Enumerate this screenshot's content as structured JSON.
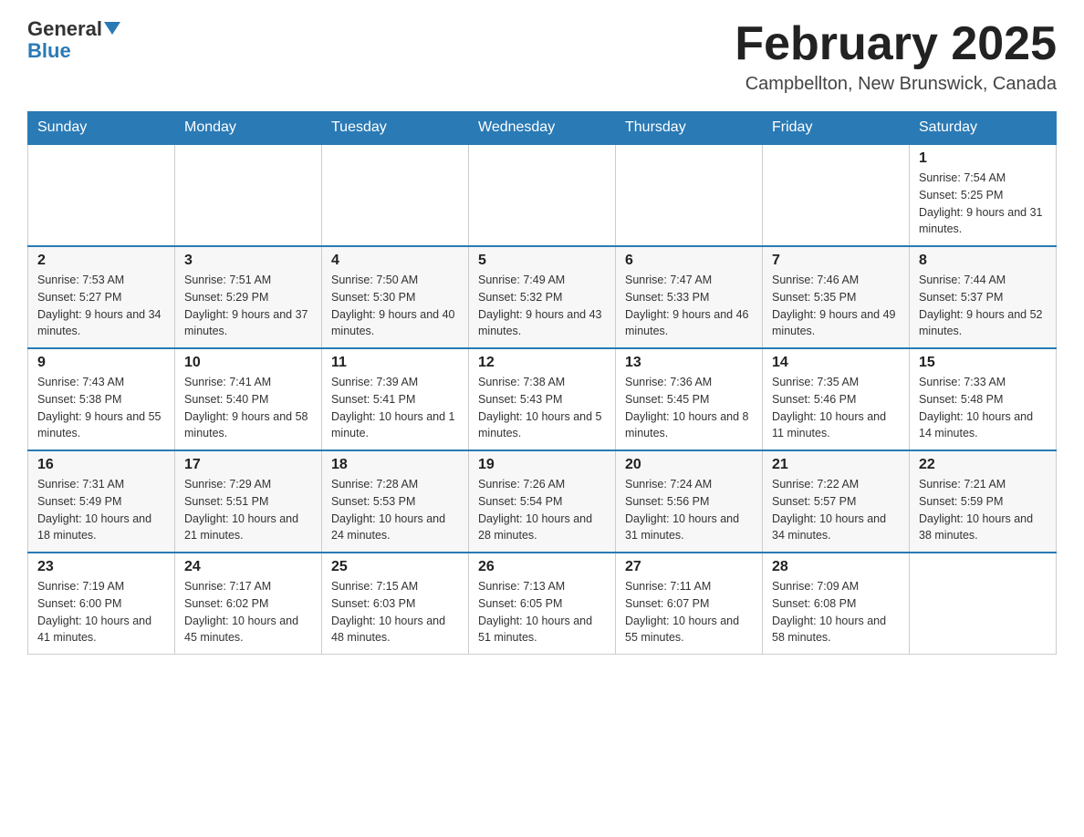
{
  "header": {
    "logo_general": "General",
    "logo_blue": "Blue",
    "month_title": "February 2025",
    "location": "Campbellton, New Brunswick, Canada"
  },
  "days_of_week": [
    "Sunday",
    "Monday",
    "Tuesday",
    "Wednesday",
    "Thursday",
    "Friday",
    "Saturday"
  ],
  "weeks": [
    {
      "days": [
        {
          "date": "",
          "info": ""
        },
        {
          "date": "",
          "info": ""
        },
        {
          "date": "",
          "info": ""
        },
        {
          "date": "",
          "info": ""
        },
        {
          "date": "",
          "info": ""
        },
        {
          "date": "",
          "info": ""
        },
        {
          "date": "1",
          "info": "Sunrise: 7:54 AM\nSunset: 5:25 PM\nDaylight: 9 hours and 31 minutes."
        }
      ]
    },
    {
      "days": [
        {
          "date": "2",
          "info": "Sunrise: 7:53 AM\nSunset: 5:27 PM\nDaylight: 9 hours and 34 minutes."
        },
        {
          "date": "3",
          "info": "Sunrise: 7:51 AM\nSunset: 5:29 PM\nDaylight: 9 hours and 37 minutes."
        },
        {
          "date": "4",
          "info": "Sunrise: 7:50 AM\nSunset: 5:30 PM\nDaylight: 9 hours and 40 minutes."
        },
        {
          "date": "5",
          "info": "Sunrise: 7:49 AM\nSunset: 5:32 PM\nDaylight: 9 hours and 43 minutes."
        },
        {
          "date": "6",
          "info": "Sunrise: 7:47 AM\nSunset: 5:33 PM\nDaylight: 9 hours and 46 minutes."
        },
        {
          "date": "7",
          "info": "Sunrise: 7:46 AM\nSunset: 5:35 PM\nDaylight: 9 hours and 49 minutes."
        },
        {
          "date": "8",
          "info": "Sunrise: 7:44 AM\nSunset: 5:37 PM\nDaylight: 9 hours and 52 minutes."
        }
      ]
    },
    {
      "days": [
        {
          "date": "9",
          "info": "Sunrise: 7:43 AM\nSunset: 5:38 PM\nDaylight: 9 hours and 55 minutes."
        },
        {
          "date": "10",
          "info": "Sunrise: 7:41 AM\nSunset: 5:40 PM\nDaylight: 9 hours and 58 minutes."
        },
        {
          "date": "11",
          "info": "Sunrise: 7:39 AM\nSunset: 5:41 PM\nDaylight: 10 hours and 1 minute."
        },
        {
          "date": "12",
          "info": "Sunrise: 7:38 AM\nSunset: 5:43 PM\nDaylight: 10 hours and 5 minutes."
        },
        {
          "date": "13",
          "info": "Sunrise: 7:36 AM\nSunset: 5:45 PM\nDaylight: 10 hours and 8 minutes."
        },
        {
          "date": "14",
          "info": "Sunrise: 7:35 AM\nSunset: 5:46 PM\nDaylight: 10 hours and 11 minutes."
        },
        {
          "date": "15",
          "info": "Sunrise: 7:33 AM\nSunset: 5:48 PM\nDaylight: 10 hours and 14 minutes."
        }
      ]
    },
    {
      "days": [
        {
          "date": "16",
          "info": "Sunrise: 7:31 AM\nSunset: 5:49 PM\nDaylight: 10 hours and 18 minutes."
        },
        {
          "date": "17",
          "info": "Sunrise: 7:29 AM\nSunset: 5:51 PM\nDaylight: 10 hours and 21 minutes."
        },
        {
          "date": "18",
          "info": "Sunrise: 7:28 AM\nSunset: 5:53 PM\nDaylight: 10 hours and 24 minutes."
        },
        {
          "date": "19",
          "info": "Sunrise: 7:26 AM\nSunset: 5:54 PM\nDaylight: 10 hours and 28 minutes."
        },
        {
          "date": "20",
          "info": "Sunrise: 7:24 AM\nSunset: 5:56 PM\nDaylight: 10 hours and 31 minutes."
        },
        {
          "date": "21",
          "info": "Sunrise: 7:22 AM\nSunset: 5:57 PM\nDaylight: 10 hours and 34 minutes."
        },
        {
          "date": "22",
          "info": "Sunrise: 7:21 AM\nSunset: 5:59 PM\nDaylight: 10 hours and 38 minutes."
        }
      ]
    },
    {
      "days": [
        {
          "date": "23",
          "info": "Sunrise: 7:19 AM\nSunset: 6:00 PM\nDaylight: 10 hours and 41 minutes."
        },
        {
          "date": "24",
          "info": "Sunrise: 7:17 AM\nSunset: 6:02 PM\nDaylight: 10 hours and 45 minutes."
        },
        {
          "date": "25",
          "info": "Sunrise: 7:15 AM\nSunset: 6:03 PM\nDaylight: 10 hours and 48 minutes."
        },
        {
          "date": "26",
          "info": "Sunrise: 7:13 AM\nSunset: 6:05 PM\nDaylight: 10 hours and 51 minutes."
        },
        {
          "date": "27",
          "info": "Sunrise: 7:11 AM\nSunset: 6:07 PM\nDaylight: 10 hours and 55 minutes."
        },
        {
          "date": "28",
          "info": "Sunrise: 7:09 AM\nSunset: 6:08 PM\nDaylight: 10 hours and 58 minutes."
        },
        {
          "date": "",
          "info": ""
        }
      ]
    }
  ]
}
